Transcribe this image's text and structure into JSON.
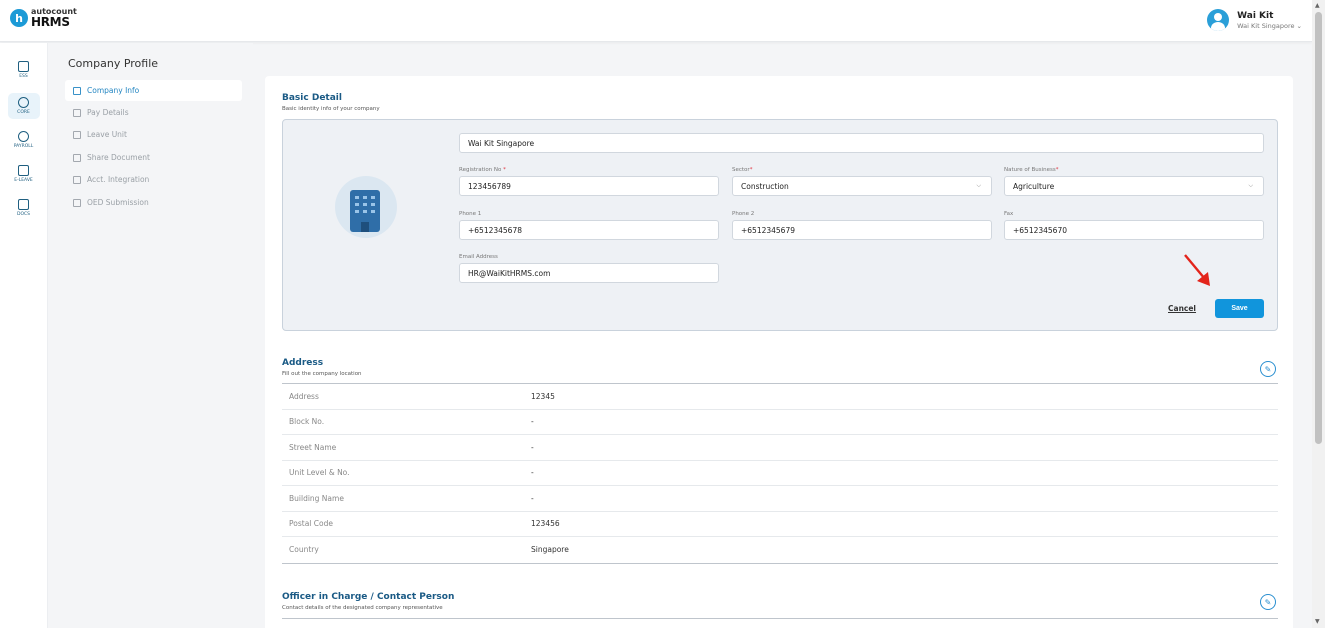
{
  "header": {
    "logo_top": "autocount",
    "logo_bottom": "HRMS",
    "logo_letter": "h",
    "user_name": "Wai Kit",
    "user_company": "Wai Kit Singapore ⌄"
  },
  "rail": [
    {
      "label": "ESS",
      "icon": "ess-icon"
    },
    {
      "label": "CORE",
      "icon": "core-icon"
    },
    {
      "label": "PAYROLL",
      "icon": "payroll-icon"
    },
    {
      "label": "E-LEAVE",
      "icon": "calendar-icon"
    },
    {
      "label": "DOCS",
      "icon": "docs-icon"
    }
  ],
  "subnav": {
    "title": "Company Profile",
    "items": [
      {
        "label": "Company Info",
        "active": true
      },
      {
        "label": "Pay Details"
      },
      {
        "label": "Leave Unit"
      },
      {
        "label": "Share Document"
      },
      {
        "label": "Acct. Integration"
      },
      {
        "label": "OED Submission"
      }
    ]
  },
  "basic": {
    "title": "Basic Detail",
    "subtitle": "Basic identity info of your company",
    "company_name": "Wai Kit Singapore",
    "reg_label": "Registration No",
    "reg_value": "123456789",
    "sector_label": "Sector",
    "sector_value": "Construction",
    "nature_label": "Nature of Business",
    "nature_value": "Agriculture",
    "phone1_label": "Phone 1",
    "phone1_value": "+6512345678",
    "phone2_label": "Phone 2",
    "phone2_value": "+6512345679",
    "fax_label": "Fax",
    "fax_value": "+6512345670",
    "email_label": "Email Address",
    "email_value": "HR@WaiKitHRMS.com",
    "cancel_label": "Cancel",
    "save_label": "Save",
    "required_mark": "*"
  },
  "address": {
    "title": "Address",
    "subtitle": "Fill out the company location",
    "rows": [
      {
        "label": "Address",
        "value": "12345"
      },
      {
        "label": "Block No.",
        "value": "-"
      },
      {
        "label": "Street Name",
        "value": "-"
      },
      {
        "label": "Unit Level & No.",
        "value": "-"
      },
      {
        "label": "Building Name",
        "value": "-"
      },
      {
        "label": "Postal Code",
        "value": "123456"
      },
      {
        "label": "Country",
        "value": "Singapore"
      }
    ]
  },
  "officer": {
    "title": "Officer in Charge / Contact Person",
    "subtitle": "Contact details of the designated company representative"
  },
  "colors": {
    "accent": "#1195dc",
    "title_blue": "#1a5a85",
    "required_red": "#e0313d"
  }
}
